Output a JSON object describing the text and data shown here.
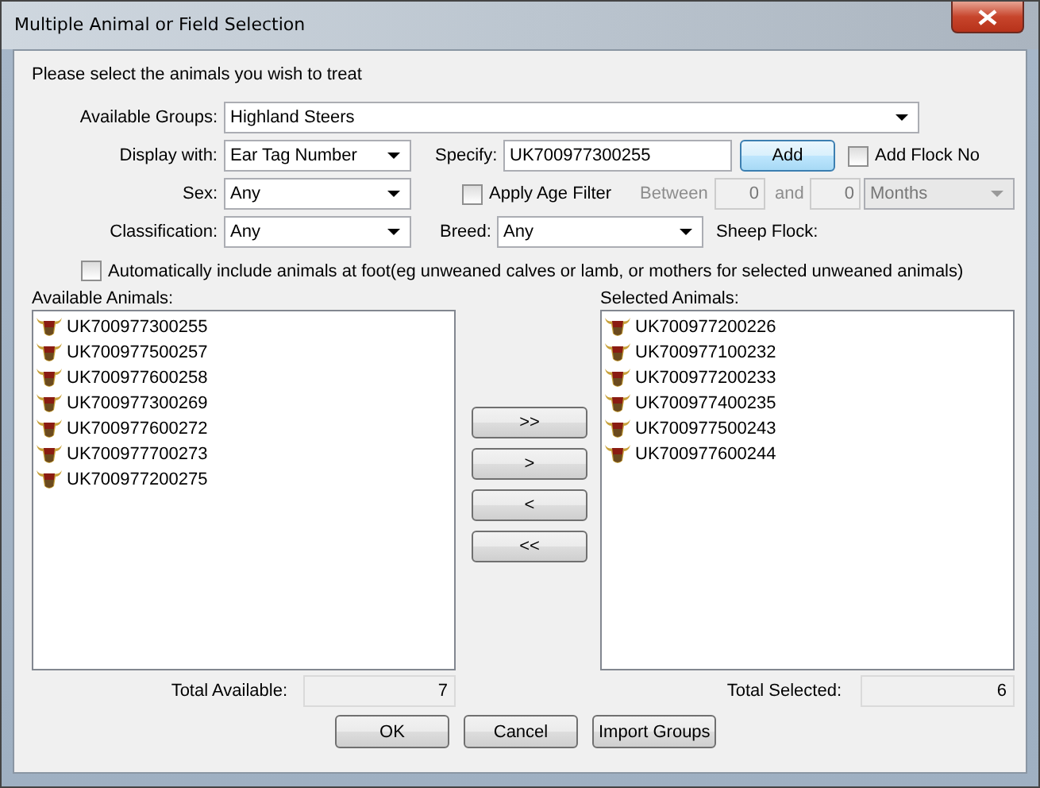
{
  "window": {
    "title": "Multiple Animal or Field Selection"
  },
  "instruction": "Please select the animals you wish to treat",
  "available_groups": {
    "label": "Available Groups:",
    "value": "Highland Steers"
  },
  "display_with": {
    "label": "Display with:",
    "value": "Ear Tag Number"
  },
  "specify": {
    "label": "Specify:",
    "value": "UK700977300255"
  },
  "add_button": {
    "label": "Add",
    "default": true
  },
  "add_flock_no": {
    "label": "Add Flock No",
    "checked": false
  },
  "sex": {
    "label": "Sex:",
    "value": "Any"
  },
  "apply_age_filter": {
    "label": "Apply Age Filter",
    "checked": false
  },
  "age_range": {
    "disabled": true,
    "between_label": "Between",
    "from": "0",
    "and_label": "and",
    "to": "0",
    "unit": "Months"
  },
  "classification": {
    "label": "Classification:",
    "value": "Any"
  },
  "breed": {
    "label": "Breed:",
    "value": "Any"
  },
  "sheep_flock": {
    "label": "Sheep Flock:"
  },
  "auto_include": {
    "label": "Automatically include animals at foot(eg unweaned calves or lamb, or mothers for selected unweaned animals)",
    "checked": false
  },
  "available_animals": {
    "label": "Available Animals:",
    "items": [
      "UK700977300255",
      "UK700977500257",
      "UK700977600258",
      "UK700977300269",
      "UK700977600272",
      "UK700977700273",
      "UK700977200275"
    ],
    "total_label": "Total Available:",
    "total": "7"
  },
  "move_buttons": [
    ">>",
    ">",
    "<",
    "<<"
  ],
  "selected_animals": {
    "label": "Selected Animals:",
    "items": [
      "UK700977200226",
      "UK700977100232",
      "UK700977200233",
      "UK700977400235",
      "UK700977500243",
      "UK700977600244"
    ],
    "total_label": "Total Selected:",
    "total": "6"
  },
  "buttons": [
    "OK",
    "Cancel",
    "Import Groups"
  ]
}
